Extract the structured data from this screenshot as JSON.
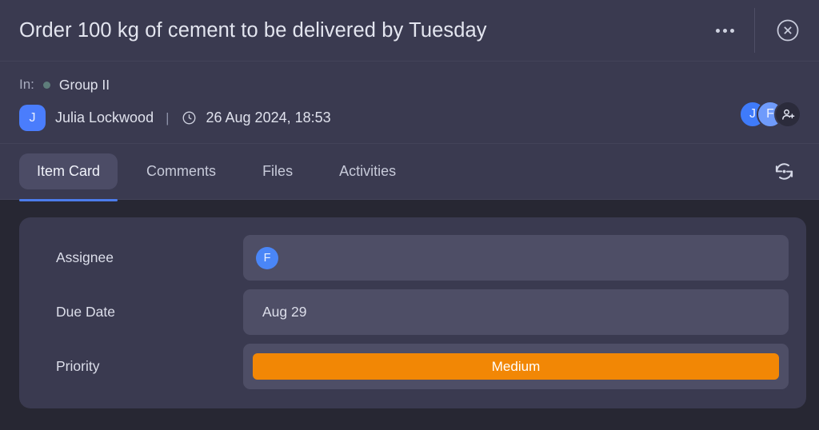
{
  "header": {
    "title": "Order 100 kg of cement to be delivered by Tuesday",
    "more_label": "",
    "close_label": ""
  },
  "meta": {
    "in_label": "In:",
    "group_name": "Group II",
    "author_initial": "J",
    "author_name": "Julia Lockwood",
    "separator": "|",
    "date": "26 Aug 2024, 18:53",
    "members": [
      {
        "initial": "J",
        "color": "#3f7bfa"
      },
      {
        "initial": "F",
        "color": "#6f9bfb"
      }
    ],
    "add_member_label": ""
  },
  "tabs": {
    "items": [
      {
        "label": "Item Card",
        "active": true
      },
      {
        "label": "Comments",
        "active": false
      },
      {
        "label": "Files",
        "active": false
      },
      {
        "label": "Activities",
        "active": false
      }
    ],
    "sync_label": ""
  },
  "item_card": {
    "fields": [
      {
        "label": "Assignee",
        "value": "F",
        "type": "avatar"
      },
      {
        "label": "Due Date",
        "value": "Aug 29",
        "type": "text"
      },
      {
        "label": "Priority",
        "value": "Medium",
        "type": "badge"
      }
    ]
  },
  "colors": {
    "accent": "#4c7ceb",
    "priority_medium": "#f28705",
    "panel": "#3a3a50",
    "field": "#4e4e66",
    "page": "#272733",
    "group_dot": "#5e7d7b"
  }
}
